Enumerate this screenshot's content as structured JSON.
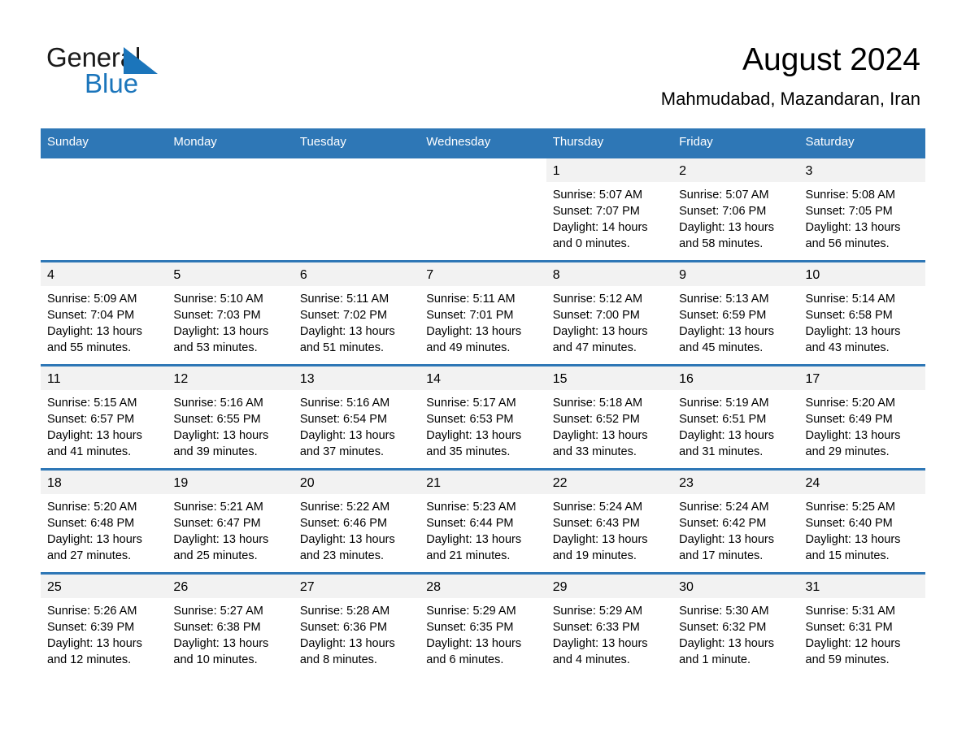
{
  "logo": {
    "word_one": "General",
    "word_two": "Blue",
    "triangle_color": "#1b75bb"
  },
  "header": {
    "title": "August 2024",
    "subtitle": "Mahmudabad, Mazandaran, Iran",
    "accent_color": "#2e77b6"
  },
  "calendar": {
    "weekday_headers": [
      "Sunday",
      "Monday",
      "Tuesday",
      "Wednesday",
      "Thursday",
      "Friday",
      "Saturday"
    ],
    "labels": {
      "sunrise": "Sunrise:",
      "sunset": "Sunset:",
      "daylight": "Daylight:"
    },
    "weeks": [
      [
        {
          "day": "",
          "sunrise": "",
          "sunset": "",
          "daylight": "",
          "empty": true
        },
        {
          "day": "",
          "sunrise": "",
          "sunset": "",
          "daylight": "",
          "empty": true
        },
        {
          "day": "",
          "sunrise": "",
          "sunset": "",
          "daylight": "",
          "empty": true
        },
        {
          "day": "",
          "sunrise": "",
          "sunset": "",
          "daylight": "",
          "empty": true
        },
        {
          "day": "1",
          "sunrise": "Sunrise: 5:07 AM",
          "sunset": "Sunset: 7:07 PM",
          "daylight": "Daylight: 14 hours and 0 minutes."
        },
        {
          "day": "2",
          "sunrise": "Sunrise: 5:07 AM",
          "sunset": "Sunset: 7:06 PM",
          "daylight": "Daylight: 13 hours and 58 minutes."
        },
        {
          "day": "3",
          "sunrise": "Sunrise: 5:08 AM",
          "sunset": "Sunset: 7:05 PM",
          "daylight": "Daylight: 13 hours and 56 minutes."
        }
      ],
      [
        {
          "day": "4",
          "sunrise": "Sunrise: 5:09 AM",
          "sunset": "Sunset: 7:04 PM",
          "daylight": "Daylight: 13 hours and 55 minutes."
        },
        {
          "day": "5",
          "sunrise": "Sunrise: 5:10 AM",
          "sunset": "Sunset: 7:03 PM",
          "daylight": "Daylight: 13 hours and 53 minutes."
        },
        {
          "day": "6",
          "sunrise": "Sunrise: 5:11 AM",
          "sunset": "Sunset: 7:02 PM",
          "daylight": "Daylight: 13 hours and 51 minutes."
        },
        {
          "day": "7",
          "sunrise": "Sunrise: 5:11 AM",
          "sunset": "Sunset: 7:01 PM",
          "daylight": "Daylight: 13 hours and 49 minutes."
        },
        {
          "day": "8",
          "sunrise": "Sunrise: 5:12 AM",
          "sunset": "Sunset: 7:00 PM",
          "daylight": "Daylight: 13 hours and 47 minutes."
        },
        {
          "day": "9",
          "sunrise": "Sunrise: 5:13 AM",
          "sunset": "Sunset: 6:59 PM",
          "daylight": "Daylight: 13 hours and 45 minutes."
        },
        {
          "day": "10",
          "sunrise": "Sunrise: 5:14 AM",
          "sunset": "Sunset: 6:58 PM",
          "daylight": "Daylight: 13 hours and 43 minutes."
        }
      ],
      [
        {
          "day": "11",
          "sunrise": "Sunrise: 5:15 AM",
          "sunset": "Sunset: 6:57 PM",
          "daylight": "Daylight: 13 hours and 41 minutes."
        },
        {
          "day": "12",
          "sunrise": "Sunrise: 5:16 AM",
          "sunset": "Sunset: 6:55 PM",
          "daylight": "Daylight: 13 hours and 39 minutes."
        },
        {
          "day": "13",
          "sunrise": "Sunrise: 5:16 AM",
          "sunset": "Sunset: 6:54 PM",
          "daylight": "Daylight: 13 hours and 37 minutes."
        },
        {
          "day": "14",
          "sunrise": "Sunrise: 5:17 AM",
          "sunset": "Sunset: 6:53 PM",
          "daylight": "Daylight: 13 hours and 35 minutes."
        },
        {
          "day": "15",
          "sunrise": "Sunrise: 5:18 AM",
          "sunset": "Sunset: 6:52 PM",
          "daylight": "Daylight: 13 hours and 33 minutes."
        },
        {
          "day": "16",
          "sunrise": "Sunrise: 5:19 AM",
          "sunset": "Sunset: 6:51 PM",
          "daylight": "Daylight: 13 hours and 31 minutes."
        },
        {
          "day": "17",
          "sunrise": "Sunrise: 5:20 AM",
          "sunset": "Sunset: 6:49 PM",
          "daylight": "Daylight: 13 hours and 29 minutes."
        }
      ],
      [
        {
          "day": "18",
          "sunrise": "Sunrise: 5:20 AM",
          "sunset": "Sunset: 6:48 PM",
          "daylight": "Daylight: 13 hours and 27 minutes."
        },
        {
          "day": "19",
          "sunrise": "Sunrise: 5:21 AM",
          "sunset": "Sunset: 6:47 PM",
          "daylight": "Daylight: 13 hours and 25 minutes."
        },
        {
          "day": "20",
          "sunrise": "Sunrise: 5:22 AM",
          "sunset": "Sunset: 6:46 PM",
          "daylight": "Daylight: 13 hours and 23 minutes."
        },
        {
          "day": "21",
          "sunrise": "Sunrise: 5:23 AM",
          "sunset": "Sunset: 6:44 PM",
          "daylight": "Daylight: 13 hours and 21 minutes."
        },
        {
          "day": "22",
          "sunrise": "Sunrise: 5:24 AM",
          "sunset": "Sunset: 6:43 PM",
          "daylight": "Daylight: 13 hours and 19 minutes."
        },
        {
          "day": "23",
          "sunrise": "Sunrise: 5:24 AM",
          "sunset": "Sunset: 6:42 PM",
          "daylight": "Daylight: 13 hours and 17 minutes."
        },
        {
          "day": "24",
          "sunrise": "Sunrise: 5:25 AM",
          "sunset": "Sunset: 6:40 PM",
          "daylight": "Daylight: 13 hours and 15 minutes."
        }
      ],
      [
        {
          "day": "25",
          "sunrise": "Sunrise: 5:26 AM",
          "sunset": "Sunset: 6:39 PM",
          "daylight": "Daylight: 13 hours and 12 minutes."
        },
        {
          "day": "26",
          "sunrise": "Sunrise: 5:27 AM",
          "sunset": "Sunset: 6:38 PM",
          "daylight": "Daylight: 13 hours and 10 minutes."
        },
        {
          "day": "27",
          "sunrise": "Sunrise: 5:28 AM",
          "sunset": "Sunset: 6:36 PM",
          "daylight": "Daylight: 13 hours and 8 minutes."
        },
        {
          "day": "28",
          "sunrise": "Sunrise: 5:29 AM",
          "sunset": "Sunset: 6:35 PM",
          "daylight": "Daylight: 13 hours and 6 minutes."
        },
        {
          "day": "29",
          "sunrise": "Sunrise: 5:29 AM",
          "sunset": "Sunset: 6:33 PM",
          "daylight": "Daylight: 13 hours and 4 minutes."
        },
        {
          "day": "30",
          "sunrise": "Sunrise: 5:30 AM",
          "sunset": "Sunset: 6:32 PM",
          "daylight": "Daylight: 13 hours and 1 minute."
        },
        {
          "day": "31",
          "sunrise": "Sunrise: 5:31 AM",
          "sunset": "Sunset: 6:31 PM",
          "daylight": "Daylight: 12 hours and 59 minutes."
        }
      ]
    ]
  }
}
